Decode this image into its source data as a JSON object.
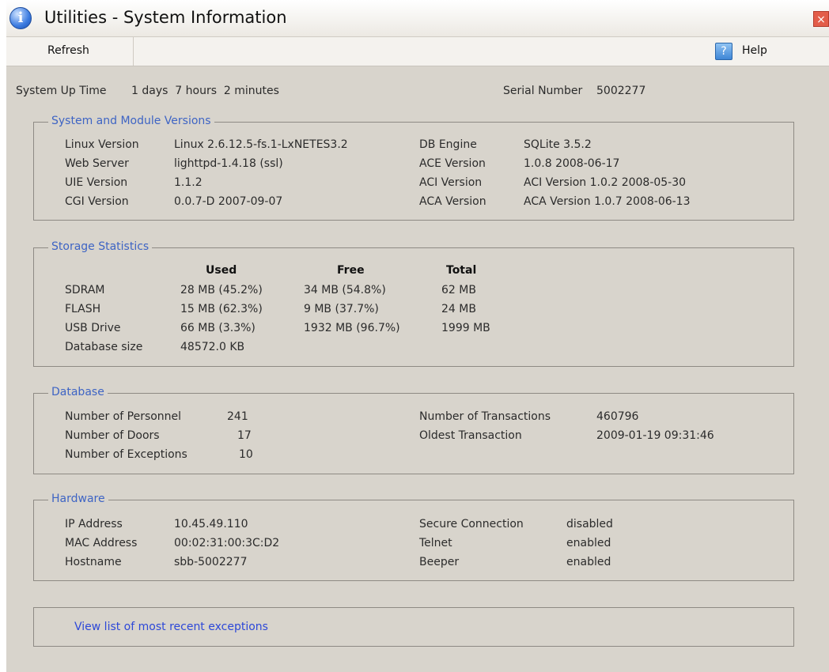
{
  "window": {
    "title": "Utilities - System Information",
    "close_glyph": "×",
    "info_glyph": "i"
  },
  "toolbar": {
    "refresh_label": "Refresh",
    "help_glyph": "?",
    "help_label": "Help"
  },
  "summary": {
    "uptime_label": "System Up Time",
    "uptime_value": "1 days  7 hours  2 minutes",
    "serial_label": "Serial Number",
    "serial_value": "5002277"
  },
  "versions": {
    "title": "System and Module Versions",
    "left": [
      {
        "label": "Linux Version",
        "value": "Linux 2.6.12.5-fs.1-LxNETES3.2"
      },
      {
        "label": "Web Server",
        "value": "lighttpd-1.4.18 (ssl)"
      },
      {
        "label": "UIE Version",
        "value": "1.1.2"
      },
      {
        "label": "CGI Version",
        "value": "0.0.7-D 2007-09-07"
      }
    ],
    "right": [
      {
        "label": "DB Engine",
        "value": "SQLite 3.5.2"
      },
      {
        "label": "ACE Version",
        "value": "1.0.8 2008-06-17"
      },
      {
        "label": "ACI Version",
        "value": "ACI Version 1.0.2 2008-05-30"
      },
      {
        "label": "ACA Version",
        "value": "ACA Version 1.0.7 2008-06-13"
      }
    ]
  },
  "storage": {
    "title": "Storage Statistics",
    "headers": {
      "used": "Used",
      "free": "Free",
      "total": "Total"
    },
    "rows": [
      {
        "name": "SDRAM",
        "used": "28 MB (45.2%)",
        "free": "34 MB (54.8%)",
        "total": "62 MB"
      },
      {
        "name": "FLASH",
        "used": "15 MB (62.3%)",
        "free": "9 MB (37.7%)",
        "total": "24 MB"
      },
      {
        "name": "USB Drive",
        "used": "66 MB (3.3%)",
        "free": "1932 MB (96.7%)",
        "total": "1999 MB"
      }
    ],
    "db_size_label": "Database size",
    "db_size_value": "48572.0 KB"
  },
  "database": {
    "title": "Database",
    "left": [
      {
        "label": "Number of Personnel",
        "value": "241"
      },
      {
        "label": "Number of Doors",
        "value": "17"
      },
      {
        "label": "Number of Exceptions",
        "value": "10"
      }
    ],
    "right": [
      {
        "label": "Number of Transactions",
        "value": "460796"
      },
      {
        "label": "Oldest Transaction",
        "value": "2009-01-19 09:31:46"
      }
    ]
  },
  "hardware": {
    "title": "Hardware",
    "left": [
      {
        "label": "IP Address",
        "value": "10.45.49.110"
      },
      {
        "label": "MAC Address",
        "value": "00:02:31:00:3C:D2"
      },
      {
        "label": "Hostname",
        "value": "sbb-5002277"
      }
    ],
    "right": [
      {
        "label": "Secure Connection",
        "value": "disabled"
      },
      {
        "label": "Telnet",
        "value": "enabled"
      },
      {
        "label": "Beeper",
        "value": "enabled"
      }
    ]
  },
  "exceptions_link": "View list of most recent exceptions",
  "colors": {
    "background": "#d8d4cc",
    "group_title": "#3e64c4",
    "link": "#2d48d8",
    "close_button": "#e35d4a"
  }
}
